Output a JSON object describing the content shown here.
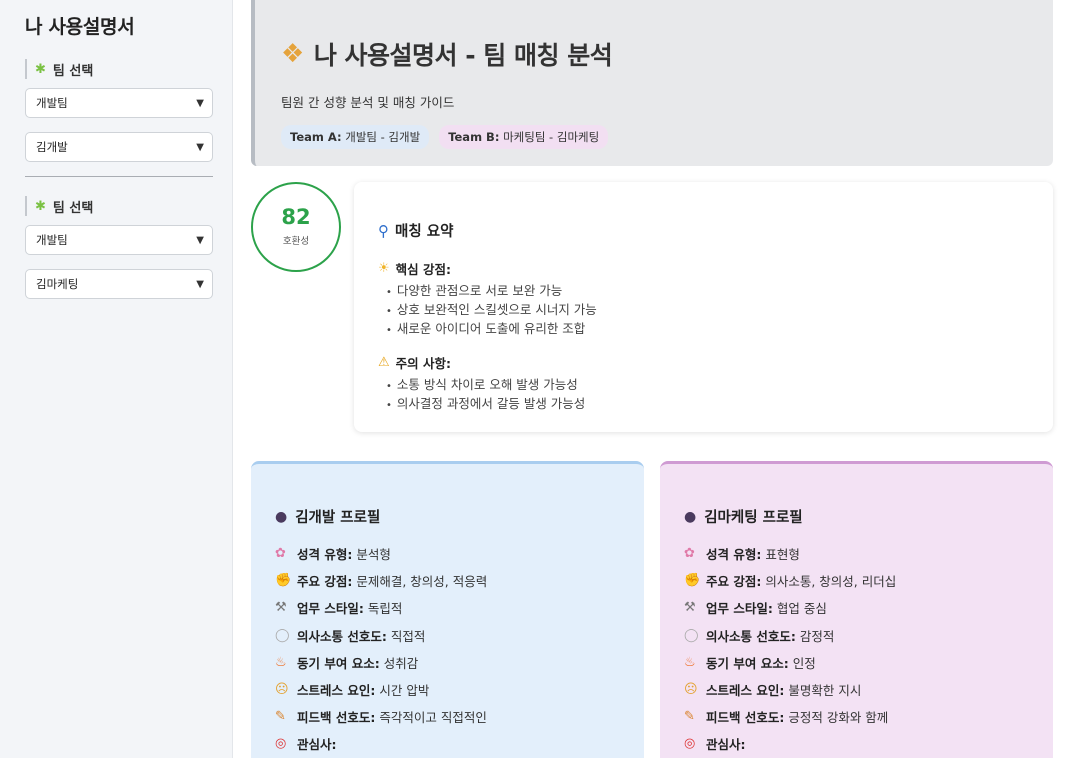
{
  "sidebar": {
    "app_title": "나 사용설명서",
    "team_a": {
      "header": "팀 선택",
      "team_value": "개발팀",
      "member_value": "김개발"
    },
    "team_b": {
      "header": "팀 선택",
      "team_value": "개발팀",
      "member_value": "김마케팅"
    }
  },
  "header": {
    "title": "나 사용설명서 - 팀 매칭 분석",
    "subtitle": "팀원 간 성향 분석 및 매칭 가이드",
    "badge_a_label": "Team A:",
    "badge_a_value": "개발팀 - 김개발",
    "badge_b_label": "Team B:",
    "badge_b_value": "마케팅팀 - 김마케팅"
  },
  "score": {
    "value": "82",
    "label": "호환성"
  },
  "summary": {
    "title": "매칭 요약",
    "strengths_title": "핵심 강점:",
    "strengths": [
      "다양한 관점으로 서로 보완 가능",
      "상호 보완적인 스킬셋으로 시너지 가능",
      "새로운 아이디어 도출에 유리한 조합"
    ],
    "cautions_title": "주의 사항:",
    "cautions": [
      "소통 방식 차이로 오해 발생 가능성",
      "의사결정 과정에서 갈등 발생 가능성"
    ]
  },
  "profiles": [
    {
      "title": "김개발 프로필",
      "rows": [
        {
          "icon": "brain-icon",
          "key": "성격 유형:",
          "value": "분석형"
        },
        {
          "icon": "muscle-icon",
          "key": "주요 강점:",
          "value": "문제해결, 창의성, 적응력"
        },
        {
          "icon": "tools-icon",
          "key": "업무 스타일:",
          "value": "독립적"
        },
        {
          "icon": "speech-bubble-icon",
          "key": "의사소통 선호도:",
          "value": "직접적"
        },
        {
          "icon": "fire-icon",
          "key": "동기 부여 요소:",
          "value": "성취감"
        },
        {
          "icon": "stressed-face-icon",
          "key": "스트레스 요인:",
          "value": "시간 압박"
        },
        {
          "icon": "memo-icon",
          "key": "피드백 선호도:",
          "value": "즉각적이고 직접적인"
        },
        {
          "icon": "target-icon",
          "key": "관심사:",
          "value": ""
        }
      ]
    },
    {
      "title": "김마케팅 프로필",
      "rows": [
        {
          "icon": "brain-icon",
          "key": "성격 유형:",
          "value": "표현형"
        },
        {
          "icon": "muscle-icon",
          "key": "주요 강점:",
          "value": "의사소통, 창의성, 리더십"
        },
        {
          "icon": "tools-icon",
          "key": "업무 스타일:",
          "value": "협업 중심"
        },
        {
          "icon": "speech-bubble-icon",
          "key": "의사소통 선호도:",
          "value": "감정적"
        },
        {
          "icon": "fire-icon",
          "key": "동기 부여 요소:",
          "value": "인정"
        },
        {
          "icon": "stressed-face-icon",
          "key": "스트레스 요인:",
          "value": "불명확한 지시"
        },
        {
          "icon": "memo-icon",
          "key": "피드백 선호도:",
          "value": "긍정적 강화와 함께"
        },
        {
          "icon": "target-icon",
          "key": "관심사:",
          "value": ""
        }
      ]
    }
  ]
}
